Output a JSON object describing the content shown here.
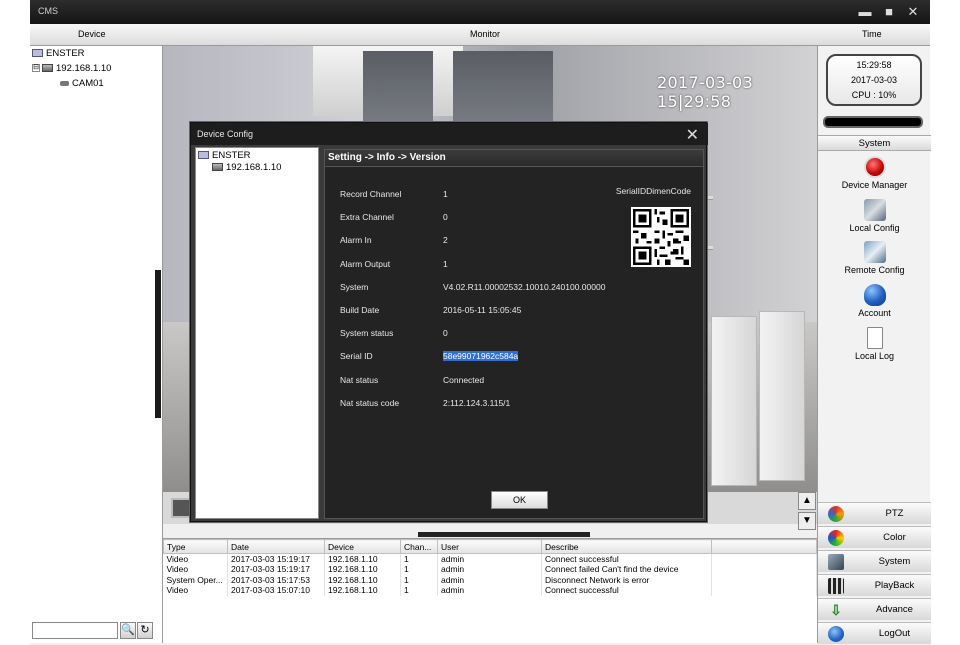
{
  "window": {
    "title": "CMS"
  },
  "columns": {
    "device": "Device",
    "monitor": "Monitor",
    "time": "Time"
  },
  "device_tree": {
    "root": "ENSTER",
    "device": "192.168.1.10",
    "camera": "CAM01",
    "expander": "⊟"
  },
  "monitor": {
    "osd_text": "2017-03-03 15|29:58"
  },
  "clock": {
    "time": "15:29:58",
    "date": "2017-03-03",
    "cpu": "CPU : 10%"
  },
  "system_panel": {
    "header": "System",
    "items": [
      {
        "label": "Device Manager",
        "icon": "device-manager-icon"
      },
      {
        "label": "Local Config",
        "icon": "local-config-icon"
      },
      {
        "label": "Remote Config",
        "icon": "remote-config-icon"
      },
      {
        "label": "Account",
        "icon": "account-icon"
      },
      {
        "label": "Local Log",
        "icon": "local-log-icon"
      }
    ]
  },
  "bottom_buttons": [
    {
      "label": "PTZ",
      "icon": "ptz-icon"
    },
    {
      "label": "Color",
      "icon": "color-icon"
    },
    {
      "label": "System",
      "icon": "system-icon"
    },
    {
      "label": "PlayBack",
      "icon": "playback-icon"
    },
    {
      "label": "Advance",
      "icon": "advance-icon"
    },
    {
      "label": "LogOut",
      "icon": "logout-icon"
    }
  ],
  "log_table": {
    "headers": [
      "Type",
      "Date",
      "Device",
      "Chan...",
      "User",
      "Describe"
    ],
    "rows": [
      [
        "Video",
        "2017-03-03 15:19:17",
        "192.168.1.10",
        "1",
        "admin",
        "Connect successful"
      ],
      [
        "Video",
        "2017-03-03 15:19:17",
        "192.168.1.10",
        "1",
        "admin",
        "Connect failed Can't find the device"
      ],
      [
        "System Oper...",
        "2017-03-03 15:17:53",
        "192.168.1.10",
        "1",
        "admin",
        "Disconnect Network is error"
      ],
      [
        "Video",
        "2017-03-03 15:07:10",
        "192.168.1.10",
        "1",
        "admin",
        "Connect successful"
      ]
    ]
  },
  "dialog": {
    "title": "Device Config",
    "tree_root": "ENSTER",
    "tree_device": "192.168.1.10",
    "breadcrumb": "Setting -> Info -> Version",
    "qr_label": "SerialIDDimenCode",
    "ok_label": "OK",
    "fields": [
      {
        "key": "Record Channel",
        "value": "1"
      },
      {
        "key": "Extra Channel",
        "value": "0"
      },
      {
        "key": "Alarm In",
        "value": "2"
      },
      {
        "key": "Alarm Output",
        "value": "1"
      },
      {
        "key": "System",
        "value": "V4.02.R11.00002532.10010.240100.00000"
      },
      {
        "key": "Build Date",
        "value": "2016-05-11 15:05:45"
      },
      {
        "key": "System status",
        "value": "0"
      },
      {
        "key": "Serial ID",
        "value": "58e99071962c584a"
      },
      {
        "key": "Nat status",
        "value": "Connected"
      },
      {
        "key": "Nat status code",
        "value": "2:112.124.3.115/1"
      }
    ]
  },
  "colors": {
    "title_bar": "#1d1d1d",
    "dialog_bg": "#232323",
    "selection": "#2f6fd0"
  }
}
